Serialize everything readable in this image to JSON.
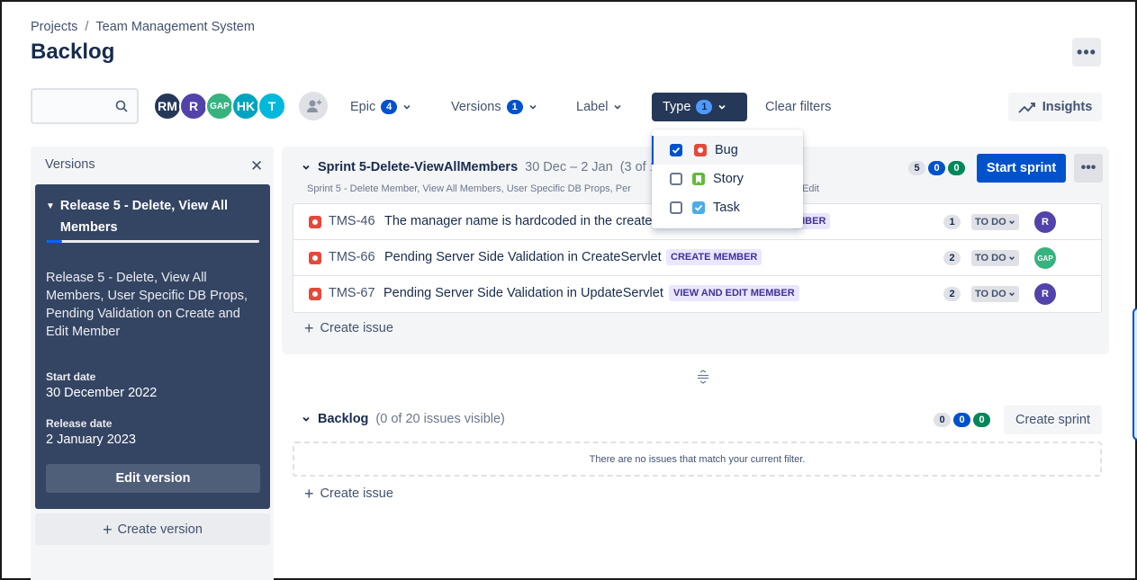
{
  "breadcrumb": {
    "projects": "Projects",
    "separator": "/",
    "project_name": "Team Management System"
  },
  "page": {
    "title": "Backlog"
  },
  "header": {
    "more_label": "•••"
  },
  "filters": {
    "search_placeholder": "",
    "avatars": [
      {
        "initials": "RM",
        "color": "#253858"
      },
      {
        "initials": "R",
        "color": "#5243aa"
      },
      {
        "initials": "GAP",
        "color": "#36b37e"
      },
      {
        "initials": "HK",
        "color": "#00a3bf"
      },
      {
        "initials": "T",
        "color": "#00b8d9"
      }
    ],
    "epic": {
      "label": "Epic",
      "count": "4"
    },
    "versions": {
      "label": "Versions",
      "count": "1"
    },
    "label": {
      "label": "Label"
    },
    "type": {
      "label": "Type",
      "count": "1"
    },
    "clear_label": "Clear filters",
    "insights_label": "Insights"
  },
  "type_dropdown": {
    "options": [
      {
        "label": "Bug",
        "checked": true
      },
      {
        "label": "Story",
        "checked": false
      },
      {
        "label": "Task",
        "checked": false
      }
    ]
  },
  "versions_panel": {
    "title": "Versions",
    "close_glyph": "✕",
    "release": {
      "name": "Release 5 - Delete, View All Members",
      "progress_fraction": 0.07,
      "description": "Release 5 - Delete, View All Members, User Specific DB Props, Pending Validation on Create and Edit Member",
      "start_label": "Start date",
      "start_value": "30 December 2022",
      "release_label": "Release date",
      "release_value": "2 January 2023",
      "edit_label": "Edit version"
    },
    "create_label": "Create version"
  },
  "sprint": {
    "name": "Sprint 5-Delete-ViewAllMembers",
    "dates": "30 Dec – 2 Jan",
    "visible_count": "(3 of 1",
    "goal": "Sprint 5 - Delete Member, View All Members, User Specific DB Props, Per",
    "goal_tail": "Edit",
    "counts": {
      "todo": "5",
      "in_progress": "0",
      "done": "0"
    },
    "start_label": "Start sprint",
    "more_label": "•••",
    "issues": [
      {
        "key": "TMS-46",
        "summary": "The manager name is hardcoded in the create",
        "epic": "MBER",
        "estimate": "1",
        "status": "TO DO",
        "assignee": "R",
        "assignee_color": "#5243aa"
      },
      {
        "key": "TMS-66",
        "summary": "Pending Server Side Validation in CreateServlet",
        "epic": "CREATE MEMBER",
        "estimate": "2",
        "status": "TO DO",
        "assignee": "GAP",
        "assignee_color": "#36b37e"
      },
      {
        "key": "TMS-67",
        "summary": "Pending Server Side Validation in UpdateServlet",
        "epic": "VIEW AND EDIT MEMBER",
        "estimate": "2",
        "status": "TO DO",
        "assignee": "R",
        "assignee_color": "#5243aa"
      }
    ],
    "create_issue_label": "Create issue"
  },
  "backlog": {
    "name": "Backlog",
    "subtitle": "(0 of 20 issues visible)",
    "counts": {
      "todo": "0",
      "in_progress": "0",
      "done": "0"
    },
    "create_sprint_label": "Create sprint",
    "empty_message": "There are no issues that match your current filter.",
    "create_issue_label": "Create issue"
  },
  "colors": {
    "primary": "#0052cc",
    "dark_nav": "#253858",
    "release_card": "#344563",
    "bug": "#e5493a",
    "story": "#63ba3c",
    "task": "#4bade8"
  }
}
